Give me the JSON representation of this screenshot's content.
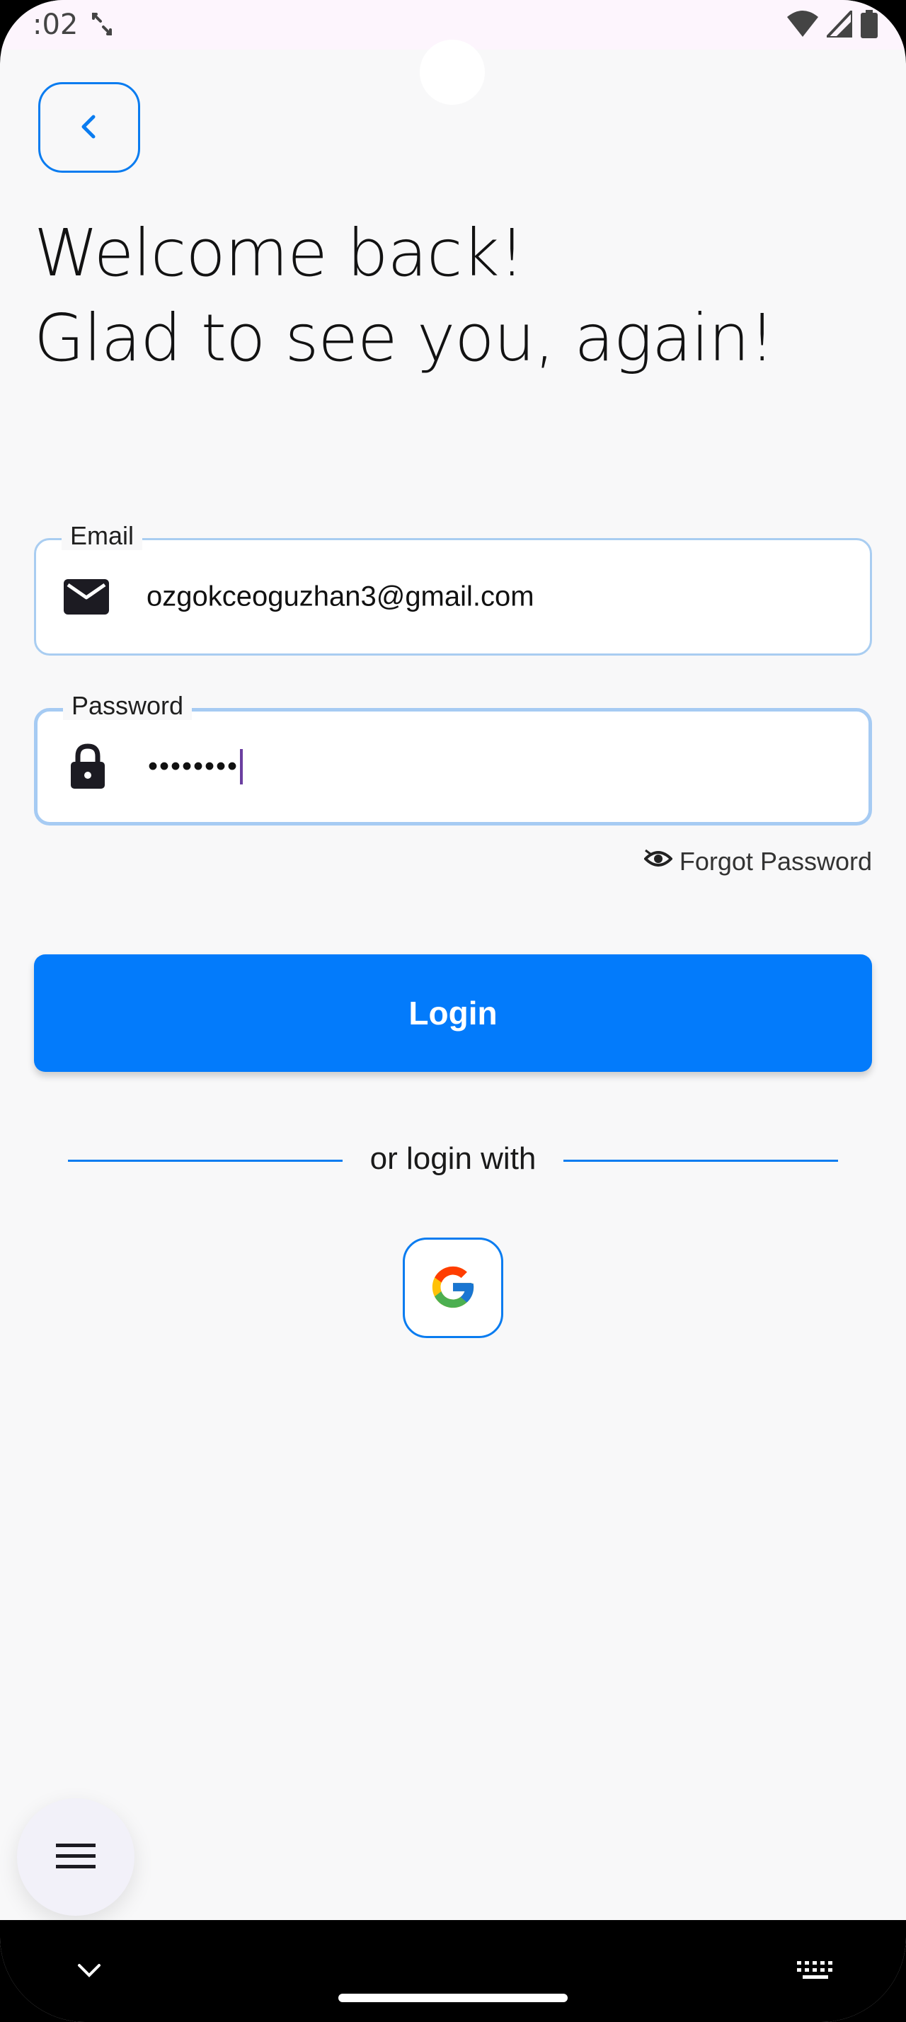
{
  "status_bar": {
    "time": ":02",
    "icons": [
      "screen-rotate-icon",
      "wifi-icon",
      "cell-signal-icon",
      "battery-icon"
    ]
  },
  "header": {
    "back_icon": "chevron-left-icon",
    "title_line1": "Welcome back!",
    "title_line2": "Glad to see you, again!"
  },
  "form": {
    "email": {
      "label": "Email",
      "value": "ozgokceoguzhan3@gmail.com",
      "icon": "mail-icon"
    },
    "password": {
      "label": "Password",
      "value": "••••••••",
      "icon": "lock-icon"
    },
    "forgot_password": {
      "label": "Forgot Password",
      "icon": "eye-icon"
    },
    "login_label": "Login"
  },
  "social": {
    "divider_text": "or login with",
    "google_icon": "google-icon"
  },
  "fab": {
    "icon": "menu-icon"
  },
  "nav_bar": {
    "icons": [
      "chevron-down-icon",
      "keyboard-icon"
    ]
  },
  "colors": {
    "accent": "#037bfb",
    "outline": "#0a7cf0",
    "field_border": "#a9cdf1",
    "background": "#f8f8f9",
    "cursor": "#6b3fa0"
  }
}
